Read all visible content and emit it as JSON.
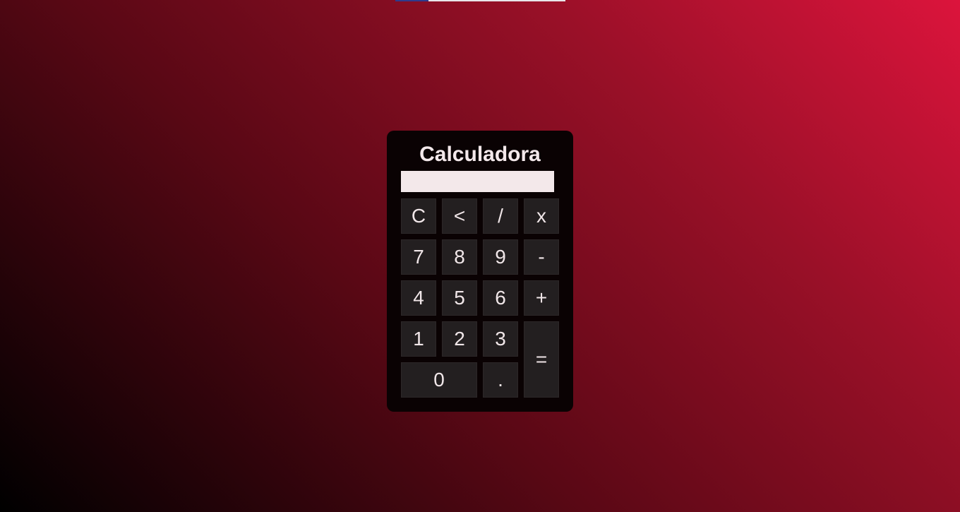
{
  "calculator": {
    "title": "Calculadora",
    "display_value": "",
    "keys": {
      "clear": "C",
      "backspace": "<",
      "divide": "/",
      "multiply": "x",
      "seven": "7",
      "eight": "8",
      "nine": "9",
      "minus": "-",
      "four": "4",
      "five": "5",
      "six": "6",
      "plus": "+",
      "one": "1",
      "two": "2",
      "three": "3",
      "equals": "=",
      "zero": "0",
      "decimal": "."
    }
  },
  "colors": {
    "background_start": "#000000",
    "background_end": "#dc143c",
    "panel": "#0a0203",
    "key": "#231f20",
    "display": "#f3e8ea",
    "text": "#f0e6e8"
  }
}
